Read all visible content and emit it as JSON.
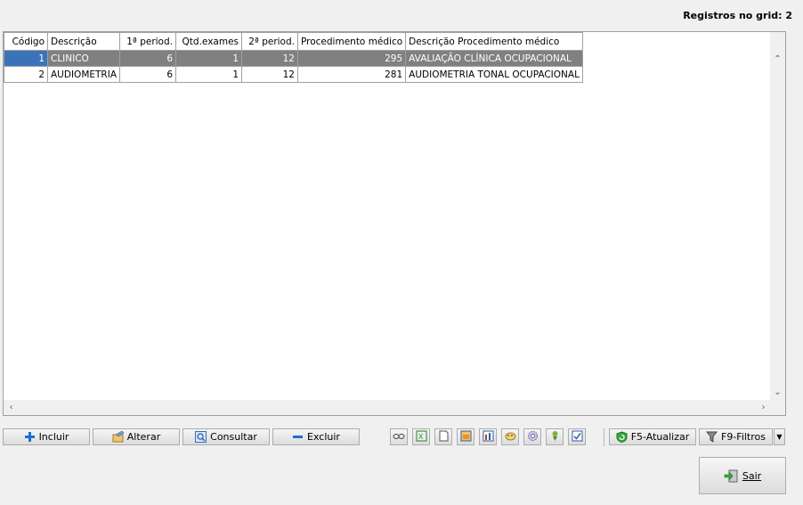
{
  "header": {
    "records_label": "Registros no grid: 2"
  },
  "grid": {
    "columns": [
      "Código",
      "Descrição",
      "1ª period.",
      "Qtd.exames",
      "2ª period.",
      "Procedimento médico",
      "Descrição Procedimento médico"
    ],
    "rows": [
      [
        "1",
        "CLINICO",
        "6",
        "1",
        "12",
        "295",
        "AVALIAÇÃO CLÍNICA OCUPACIONAL"
      ],
      [
        "2",
        "AUDIOMETRIA",
        "6",
        "1",
        "12",
        "281",
        "AUDIOMETRIA TONAL OCUPACIONAL"
      ]
    ],
    "selected_row": 0
  },
  "actions": {
    "incluir": "Incluir",
    "alterar": "Alterar",
    "consultar": "Consultar",
    "excluir": "Excluir",
    "atualizar": "F5-Atualizar",
    "filtros": "F9-Filtros",
    "sair": "Sair"
  },
  "toolbar_icons": [
    "view-icon",
    "excel-icon",
    "document-icon",
    "folder-icon",
    "chart-icon",
    "palette-icon",
    "settings-icon",
    "download-icon",
    "checklist-icon"
  ],
  "colors": {
    "selection": "#808080",
    "selection_focus": "#3b73b9",
    "add": "#1e6fd0",
    "remove": "#1e6fd0"
  }
}
